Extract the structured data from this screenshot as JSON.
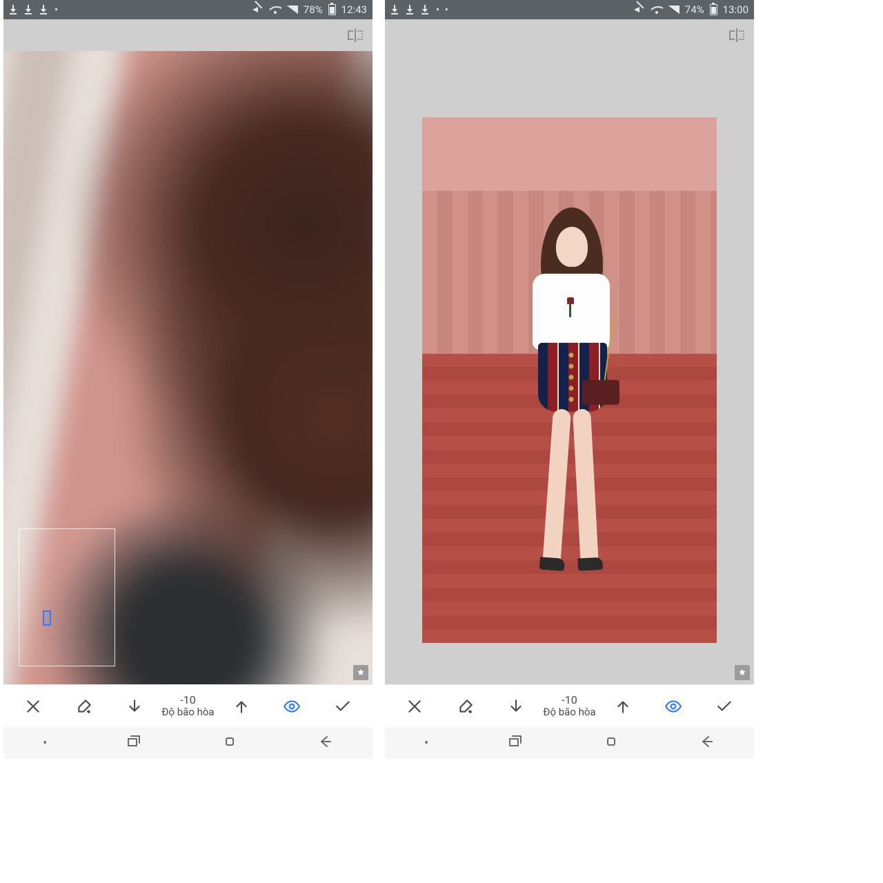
{
  "left": {
    "status": {
      "battery_pct": "78%",
      "time": "12:43"
    },
    "adjust": {
      "value": "-10",
      "label": "Độ bão hòa"
    }
  },
  "right": {
    "status": {
      "battery_pct": "74%",
      "time": "13:00"
    },
    "adjust": {
      "value": "-10",
      "label": "Độ bão hòa"
    }
  },
  "icons": {
    "mirror": "mirror-icon",
    "bookmark": "bookmark-star-icon",
    "close": "close-icon",
    "brush": "brush-settings-icon",
    "arrow_down": "arrow-down-icon",
    "arrow_up": "arrow-up-icon",
    "eye": "visibility-icon",
    "check": "confirm-icon",
    "recents": "recents-icon",
    "home": "home-icon",
    "back": "back-icon"
  }
}
